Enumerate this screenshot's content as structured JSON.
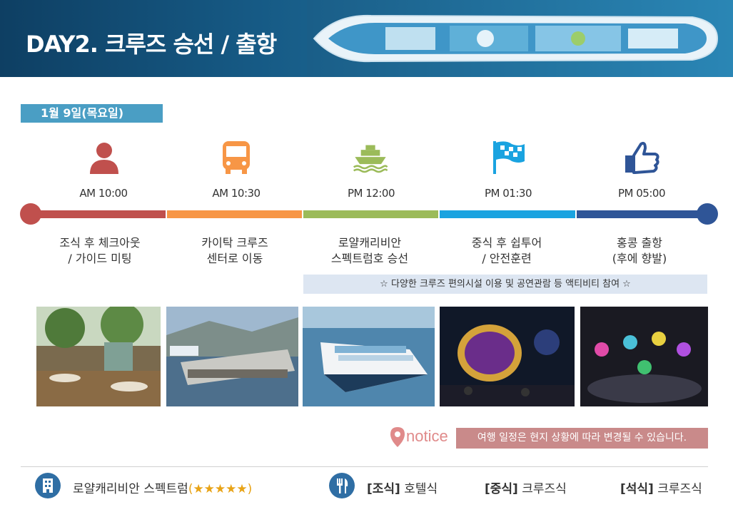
{
  "header": {
    "title": "DAY2. 크루즈 승선 / 출항"
  },
  "date": "1월 9일(목요일)",
  "timeline": [
    {
      "icon": "person-icon",
      "time": "AM 10:00",
      "line1": "조식 후 체크아웃",
      "line2": "/ 가이드 미팅",
      "color": "#c0504d"
    },
    {
      "icon": "bus-icon",
      "time": "AM 10:30",
      "line1": "카이탁 크루즈",
      "line2": "센터로 이동",
      "color": "#f79646"
    },
    {
      "icon": "ship-icon",
      "time": "PM 12:00",
      "line1": "로얄캐리비안",
      "line2": "스펙트럼호 승선",
      "color": "#9bbb59"
    },
    {
      "icon": "flag-icon",
      "time": "PM 01:30",
      "line1": "중식 후 쉽투어",
      "line2": "/ 안전훈련",
      "color": "#1aa3e0"
    },
    {
      "icon": "thumbs-up-icon",
      "time": "PM 05:00",
      "line1": "홍콩 출항",
      "line2": "(후에 향발)",
      "color": "#2f5597"
    }
  ],
  "activity": "☆ 다양한 크루즈 편의시설 이용 및 공연관람 등 액티비티 참여 ☆",
  "notice": {
    "label": "notice",
    "text": "여행 일정은 현지 상황에 따라 변경될 수 있습니다."
  },
  "footer": {
    "hotel": "로얄캐리비안 스펙트럼",
    "hotel_stars": "(★★★★★)",
    "breakfast_label": "[조식]",
    "breakfast_value": " 호텔식",
    "lunch_label": "[중식]",
    "lunch_value": " 크루즈식",
    "dinner_label": "[석식]",
    "dinner_value": " 크루즈식"
  }
}
